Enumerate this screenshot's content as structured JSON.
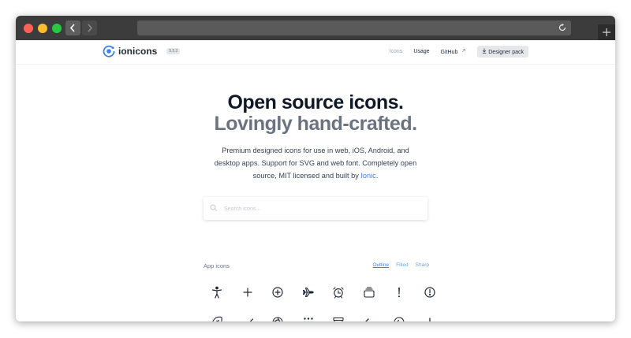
{
  "browser": {
    "traffic_colors": {
      "close": "#fe5f57",
      "minimize": "#febc2e",
      "zoom": "#28c840"
    },
    "icons": [
      "back-icon",
      "forward-icon",
      "reload-icon",
      "new-tab-icon"
    ]
  },
  "nav": {
    "brand": "ionicons",
    "version": "5.5.2",
    "links": [
      "Icons",
      "Usage",
      "GitHub"
    ],
    "designer_pack": "Designer pack"
  },
  "hero": {
    "title_line1": "Open source icons.",
    "title_line2": "Lovingly hand-crafted.",
    "desc_line1": "Premium designed icons for use in web, iOS, Android, and",
    "desc_line2": "desktop apps. Support for SVG and web font. Completely open",
    "desc_line3_pre": "source, MIT licensed and built by ",
    "desc_line3_link": "Ionic",
    "desc_line3_post": "."
  },
  "search": {
    "placeholder": "Search icons..."
  },
  "icons_section": {
    "title": "App icons",
    "tabs": [
      "Outline",
      "Filled",
      "Sharp"
    ],
    "active_tab": "Outline",
    "row1": [
      "accessibility-icon",
      "add-icon",
      "add-circle-icon",
      "airplane-icon",
      "alarm-icon",
      "albums-icon",
      "alert-icon",
      "alert-circle-icon"
    ],
    "row2": [
      "american-football-icon",
      "analytics-icon",
      "aperture-icon",
      "apps-icon",
      "archive-icon",
      "arrow-back-icon",
      "arrow-back-circle-icon",
      "arrow-down-icon"
    ]
  },
  "colors": {
    "accent": "#3b82f6",
    "heading": "#111827",
    "subheading": "#6b7280"
  }
}
